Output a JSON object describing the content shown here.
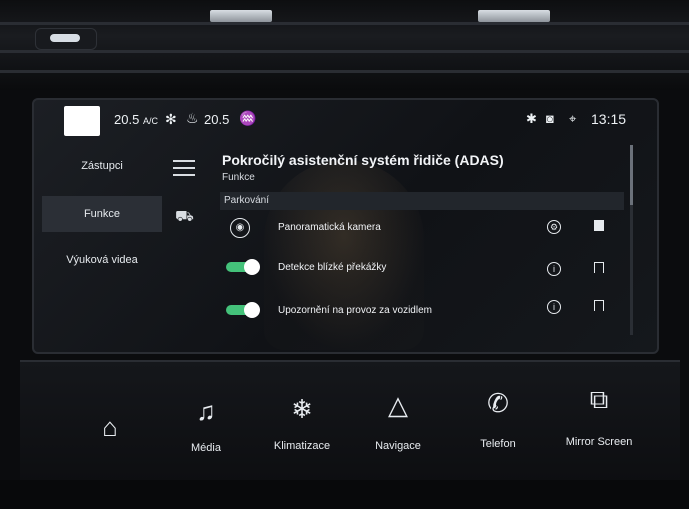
{
  "status_bar": {
    "temp_left": "20.5",
    "temp_left_suffix": "A/C",
    "temp_right": "20.5",
    "time": "13:15",
    "icons": [
      "fan-icon",
      "seat-heat-icon",
      "rear-heat-icon",
      "bluetooth-icon",
      "car-connect-icon",
      "location-icon"
    ]
  },
  "left_nav": {
    "items": [
      {
        "label": "Zástupci"
      },
      {
        "label": "Funkce"
      },
      {
        "label": "Výuková videa"
      }
    ],
    "active_index": 1
  },
  "page": {
    "title": "Pokročilý asistenční systém řidiče (ADAS)",
    "subtitle": "Funkce",
    "section": "Parkování"
  },
  "rows": [
    {
      "label": "Panoramatická kamera",
      "type": "camera",
      "on": null
    },
    {
      "label": "Detekce blízké překážky",
      "type": "toggle",
      "on": true
    },
    {
      "label": "Upozornění na provoz za vozidlem",
      "type": "toggle",
      "on": true
    }
  ],
  "bottom_bar": {
    "buttons": [
      {
        "label": "",
        "icon": "home-icon"
      },
      {
        "label": "Média",
        "icon": "music-note-icon"
      },
      {
        "label": "Klimatizace",
        "icon": "climate-icon"
      },
      {
        "label": "Navigace",
        "icon": "navigation-arrow-icon"
      },
      {
        "label": "Telefon",
        "icon": "phone-icon"
      },
      {
        "label": "Mirror Screen",
        "icon": "mirror-screen-icon"
      }
    ]
  }
}
